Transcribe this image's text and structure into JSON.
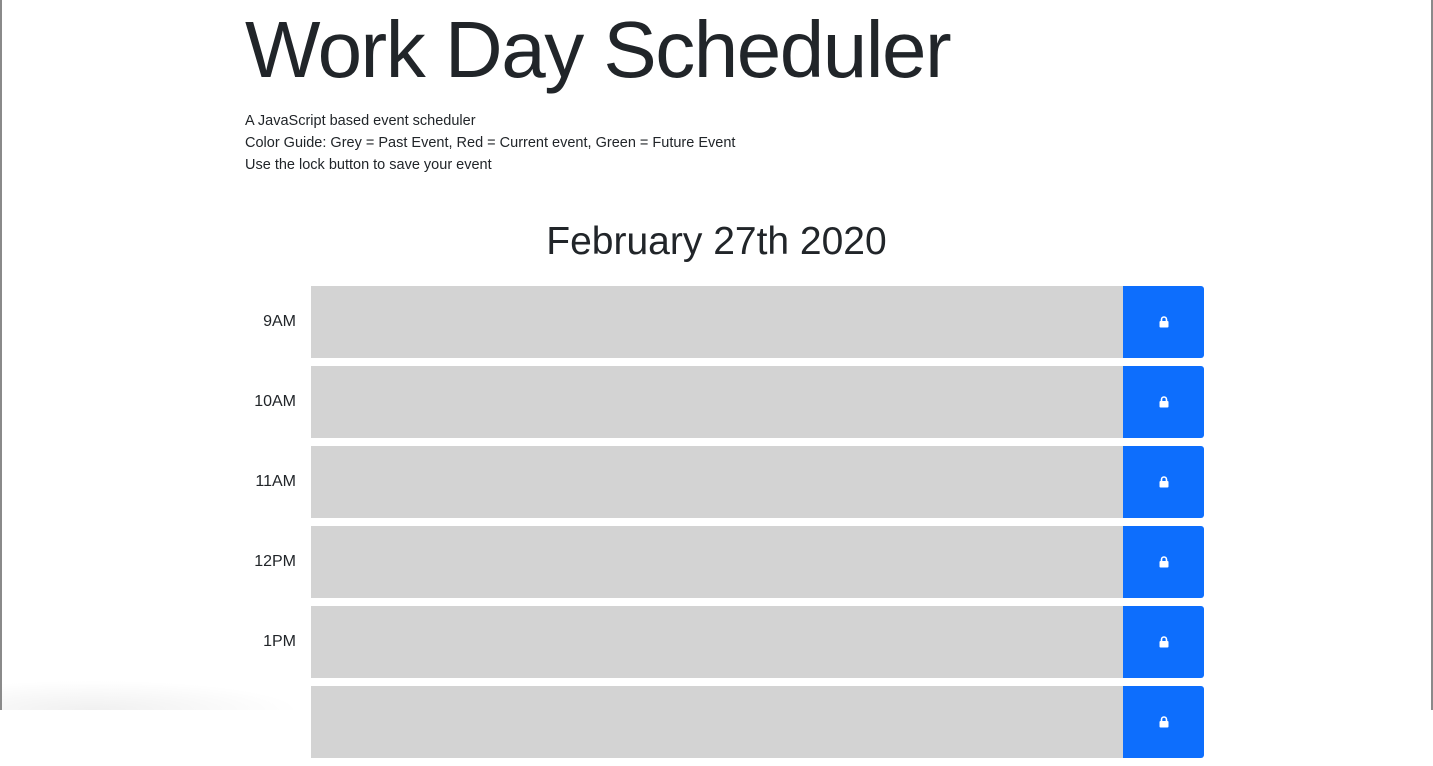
{
  "header": {
    "title": "Work Day Scheduler",
    "lead_lines": [
      "A JavaScript based event scheduler",
      "Color Guide: Grey = Past Event, Red = Current event, Green = Future Event",
      "Use the lock button to save your event"
    ]
  },
  "current_day": "February 27th 2020",
  "time_blocks": [
    {
      "hour": "9AM",
      "status": "past",
      "event": ""
    },
    {
      "hour": "10AM",
      "status": "past",
      "event": ""
    },
    {
      "hour": "11AM",
      "status": "past",
      "event": ""
    },
    {
      "hour": "12PM",
      "status": "past",
      "event": ""
    },
    {
      "hour": "1PM",
      "status": "past",
      "event": ""
    },
    {
      "hour": "",
      "status": "past",
      "event": ""
    }
  ],
  "save_button": {
    "icon": "lock-icon"
  },
  "colors": {
    "past": "#d3d3d3",
    "save_button": "#0d6efd",
    "text": "#212529"
  }
}
